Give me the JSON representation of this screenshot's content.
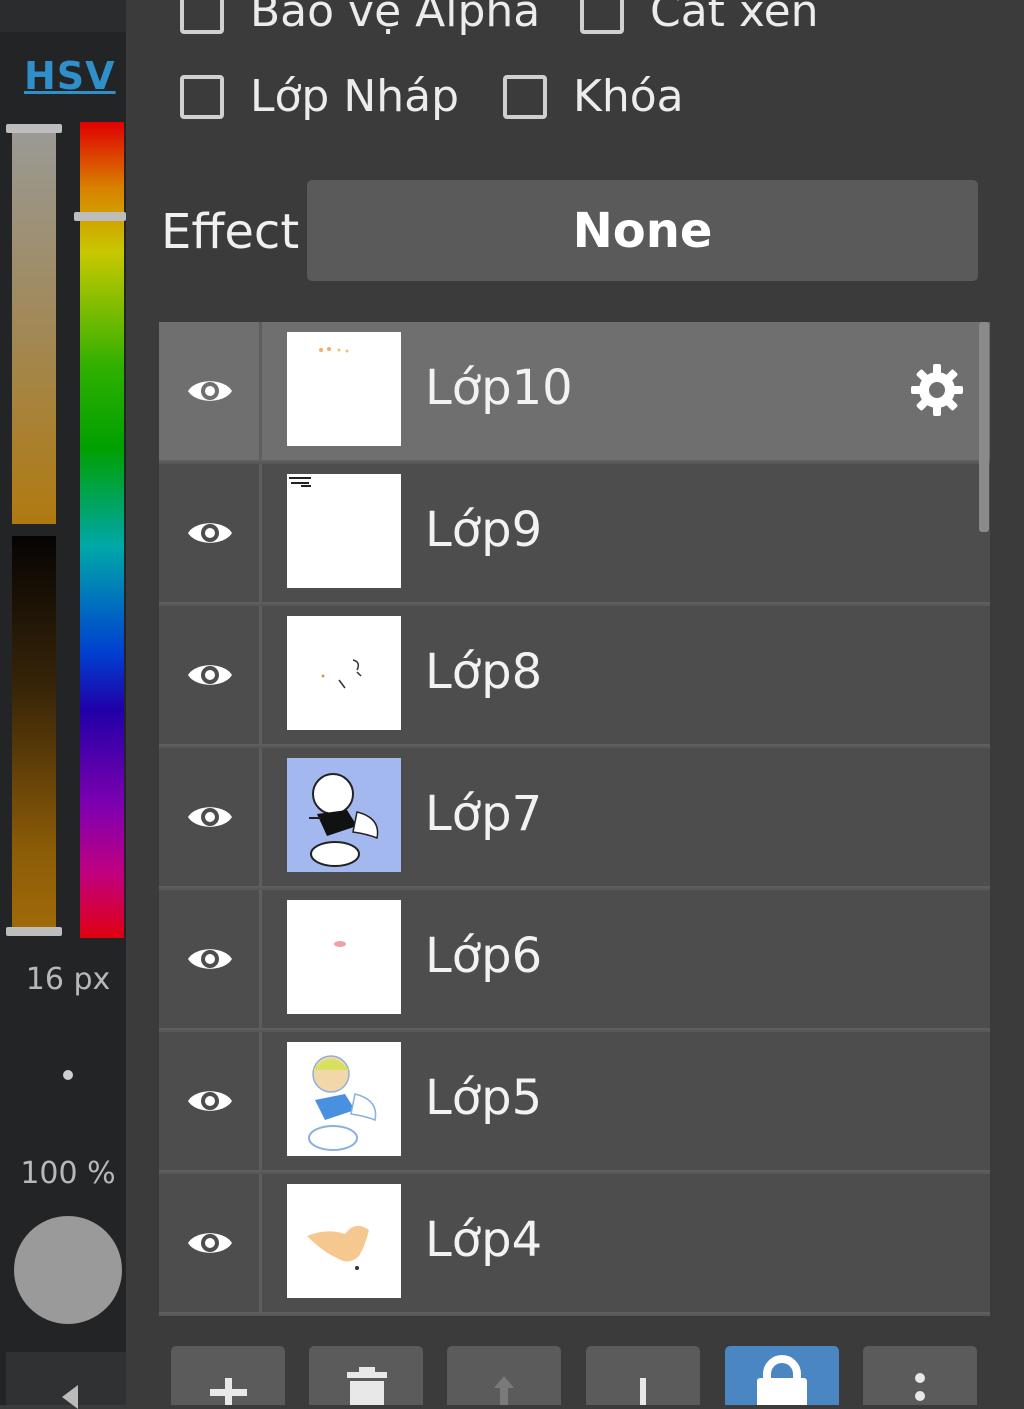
{
  "color_panel": {
    "mode_label": "HSV",
    "brush_size": "16 px",
    "opacity": "100 %"
  },
  "layer_options": {
    "protect_alpha": "Bảo vệ Alpha",
    "clipping": "Cắt xén",
    "draft_layer": "Lớp Nháp",
    "lock": "Khóa"
  },
  "effect": {
    "label": "Effect",
    "value": "None"
  },
  "layers": [
    {
      "name": "Lớp10",
      "selected": true,
      "visible": true
    },
    {
      "name": "Lớp9",
      "selected": false,
      "visible": true
    },
    {
      "name": "Lớp8",
      "selected": false,
      "visible": true
    },
    {
      "name": "Lớp7",
      "selected": false,
      "visible": true
    },
    {
      "name": "Lớp6",
      "selected": false,
      "visible": true
    },
    {
      "name": "Lớp5",
      "selected": false,
      "visible": true
    },
    {
      "name": "Lớp4",
      "selected": false,
      "visible": true
    }
  ],
  "toolbar": [
    {
      "icon": "plus-icon"
    },
    {
      "icon": "trash-icon"
    },
    {
      "icon": "move-up-icon"
    },
    {
      "icon": "move-down-icon"
    },
    {
      "icon": "lock-icon",
      "active": true
    },
    {
      "icon": "more-vertical-icon"
    }
  ],
  "colors": {
    "accent": "#4a86c1",
    "panel_bg": "#3b3b3b",
    "selected_layer": "#6f6f6f",
    "layer_bg": "#4d4d4d"
  }
}
